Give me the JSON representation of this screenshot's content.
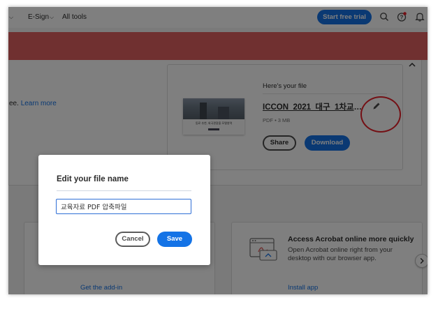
{
  "nav": {
    "items": [
      {
        "label": "",
        "has_chevron": true
      },
      {
        "label": "E-Sign",
        "has_chevron": true
      },
      {
        "label": "All tools",
        "has_chevron": false
      }
    ],
    "trial_label": "Start free trial",
    "icons": [
      "search-icon",
      "help-icon",
      "bell-icon"
    ],
    "accent": "#1473e6"
  },
  "banner": {
    "color": "#e06060"
  },
  "intro": {
    "text_prefix": "ee.",
    "link": "Learn more"
  },
  "file_card": {
    "heading": "Here's your file",
    "file_name": "ICCON_2021_대구_1차교육_3...",
    "meta": "PDF • 3 MB",
    "share_label": "Share",
    "download_label": "Download",
    "thumbnail_caption": "동료 추천, 외국관광을 모델영역"
  },
  "addon_card": {
    "link": "Get the add-in"
  },
  "acrobat_card": {
    "title": "Access Acrobat online more quickly",
    "description": "Open Acrobat online right from your desktop with our browser app.",
    "link": "Install app"
  },
  "dialog": {
    "title": "Edit your file name",
    "input_value": "교육자료 PDF 압축파일",
    "cancel_label": "Cancel",
    "save_label": "Save"
  },
  "annotation": {
    "circle_color": "#e8202a"
  }
}
